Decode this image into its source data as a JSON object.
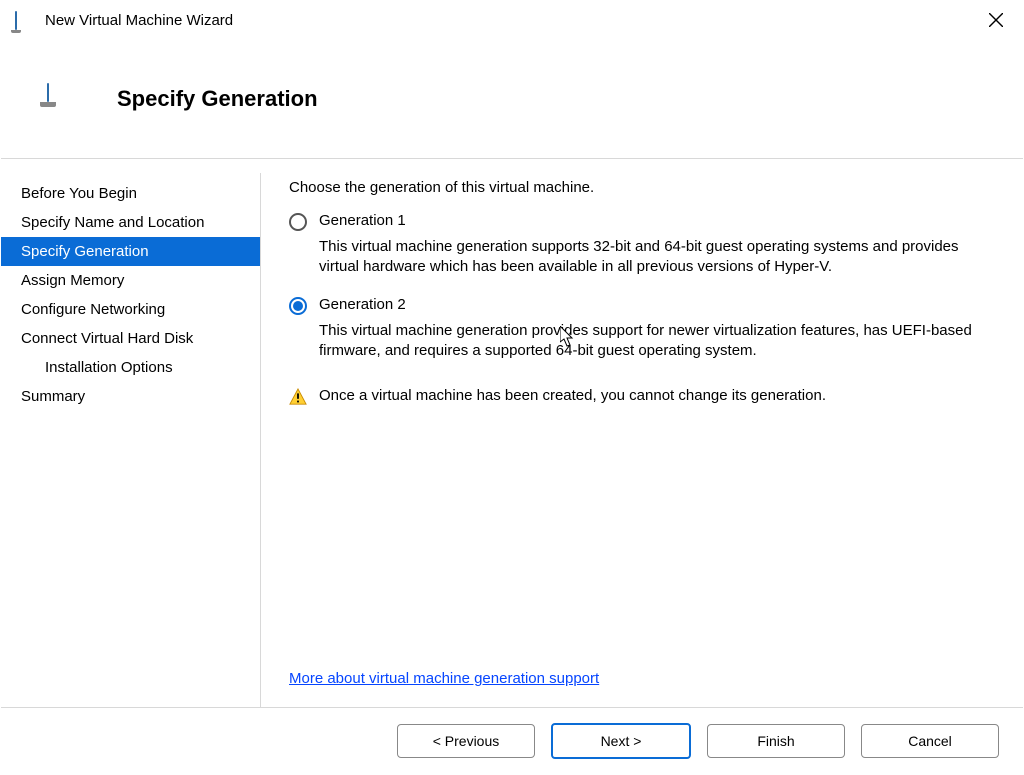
{
  "window": {
    "title": "New Virtual Machine Wizard"
  },
  "header": {
    "heading": "Specify Generation"
  },
  "sidebar": {
    "items": [
      {
        "label": "Before You Begin",
        "selected": false,
        "indent": false
      },
      {
        "label": "Specify Name and Location",
        "selected": false,
        "indent": false
      },
      {
        "label": "Specify Generation",
        "selected": true,
        "indent": false
      },
      {
        "label": "Assign Memory",
        "selected": false,
        "indent": false
      },
      {
        "label": "Configure Networking",
        "selected": false,
        "indent": false
      },
      {
        "label": "Connect Virtual Hard Disk",
        "selected": false,
        "indent": false
      },
      {
        "label": "Installation Options",
        "selected": false,
        "indent": true
      },
      {
        "label": "Summary",
        "selected": false,
        "indent": false
      }
    ]
  },
  "content": {
    "prompt": "Choose the generation of this virtual machine.",
    "options": [
      {
        "label": "Generation 1",
        "selected": false,
        "description": "This virtual machine generation supports 32-bit and 64-bit guest operating systems and provides virtual hardware which has been available in all previous versions of Hyper-V."
      },
      {
        "label": "Generation 2",
        "selected": true,
        "description": "This virtual machine generation provides support for newer virtualization features, has UEFI-based firmware, and requires a supported 64-bit guest operating system."
      }
    ],
    "warning": "Once a virtual machine has been created, you cannot change its generation.",
    "more_link": "More about virtual machine generation support"
  },
  "footer": {
    "previous": "< Previous",
    "next": "Next >",
    "finish": "Finish",
    "cancel": "Cancel"
  }
}
